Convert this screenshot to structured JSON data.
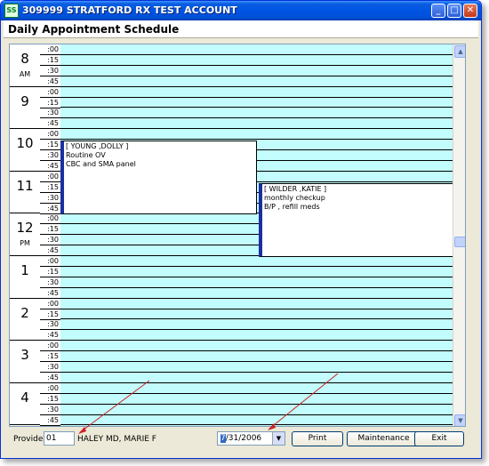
{
  "window": {
    "title": "309999 STRATFORD RX TEST ACCOUNT",
    "app_icon_text": "SS",
    "controls": {
      "minimize": "_",
      "maximize": "□",
      "close": "✕"
    }
  },
  "header": {
    "title": "Daily Appointment Schedule"
  },
  "schedule": {
    "hours": [
      {
        "label": "8",
        "period": "AM"
      },
      {
        "label": "9",
        "period": ""
      },
      {
        "label": "10",
        "period": ""
      },
      {
        "label": "11",
        "period": ""
      },
      {
        "label": "12",
        "period": "PM"
      },
      {
        "label": "1",
        "period": ""
      },
      {
        "label": "2",
        "period": ""
      },
      {
        "label": "3",
        "period": ""
      },
      {
        "label": "4",
        "period": ""
      }
    ],
    "minutes": [
      ":00",
      ":15",
      ":30",
      ":45"
    ],
    "appointments": [
      {
        "patient": "[ YOUNG ,DOLLY   ]",
        "line1": "Routine OV",
        "line2": "CBC and SMA panel"
      },
      {
        "patient": "[ WILDER ,KATIE   ]",
        "line1": "monthly checkup",
        "line2": "B/P , refill meds"
      }
    ],
    "colors": {
      "slot_bg": "#c2fcfc",
      "appointment_bar": "#1c2fa0"
    }
  },
  "footer": {
    "provider_label": "Provider",
    "provider_id": "01",
    "provider_name": "HALEY MD, MARIE F",
    "date_month": "7",
    "date_rest": "/31/2006",
    "print_label": "Print",
    "maintenance_label": "Maintenance",
    "exit_label": "Exit"
  }
}
